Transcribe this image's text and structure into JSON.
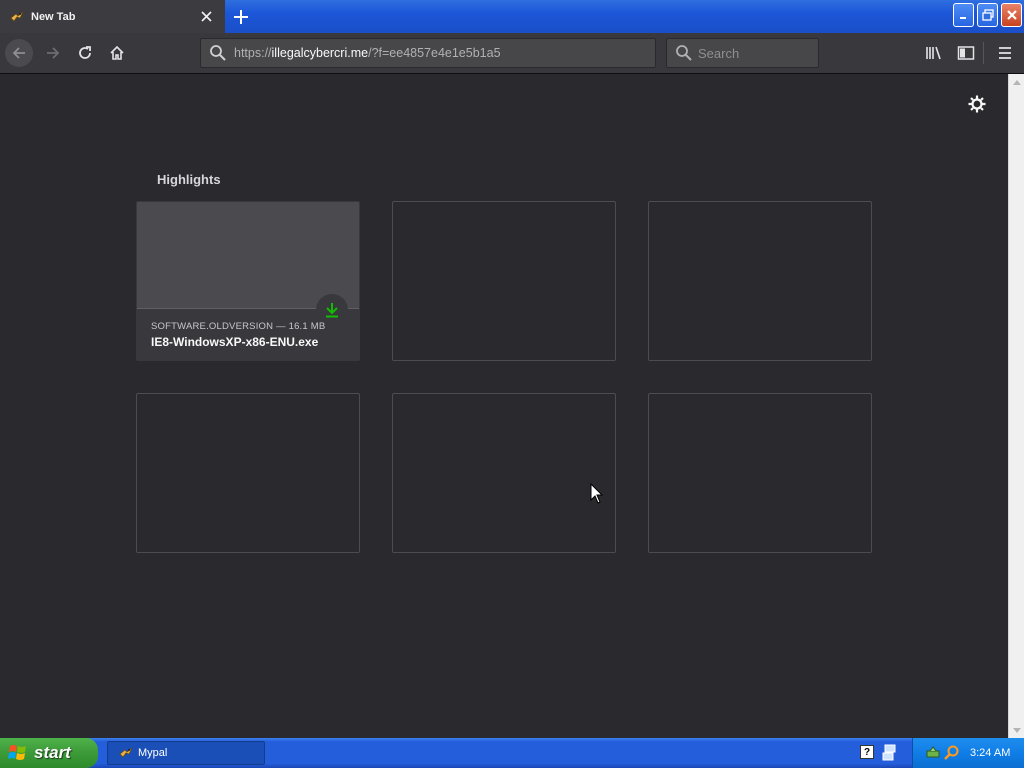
{
  "browser": {
    "tab": {
      "title": "New Tab"
    },
    "urlbar": {
      "prefix": "https://",
      "domain": "illegalcybercri.me",
      "path": "/?f=ee4857e4e1e5b1a5"
    },
    "search": {
      "placeholder": "Search"
    }
  },
  "newtab": {
    "section_title": "Highlights",
    "highlights": [
      {
        "source": "SOFTWARE.OLDVERSION — 16.1 MB",
        "filename": "IE8-WindowsXP-x86-ENU.exe"
      }
    ]
  },
  "taskbar": {
    "start_label": "start",
    "task_label": "Mypal",
    "clock": "3:24 AM"
  },
  "colors": {
    "content_bg": "#2a2a2e",
    "toolbar_bg": "#38383d",
    "download_green": "#12bc00",
    "xp_blue": "#245edb"
  }
}
